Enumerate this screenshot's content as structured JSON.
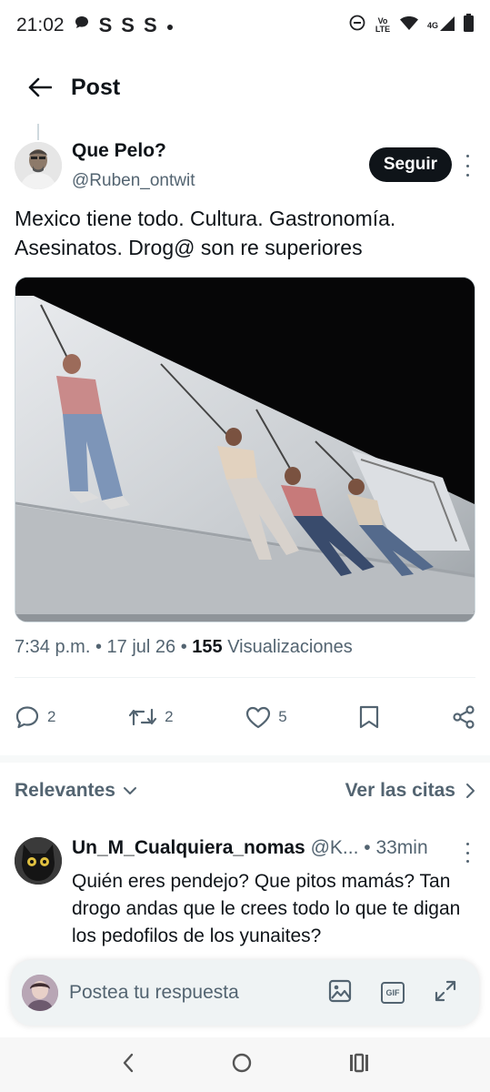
{
  "status_bar": {
    "time": "21:02",
    "app_letters": [
      "S",
      "S",
      "S"
    ],
    "volte_label": "Vo LTE",
    "network": "4G"
  },
  "header": {
    "title": "Post"
  },
  "post": {
    "author_name": "Que Pelo?",
    "author_handle": "@Ruben_ontwit",
    "follow_label": "Seguir",
    "text": "Mexico tiene todo. Cultura. Gastronomía. Asesinatos. Drog@ son re superiores",
    "time": "7:34 p.m.",
    "date": "17 jul 26",
    "views_count": "155",
    "views_label": "Visualizaciones",
    "reply_count": "2",
    "repost_count": "2",
    "like_count": "5"
  },
  "replies_section": {
    "sort_label": "Relevantes",
    "quotes_label": "Ver las citas"
  },
  "reply": {
    "name": "Un_M_Cualquiera_nomas",
    "handle": "@K...",
    "time": "33min",
    "text": "Quién eres pendejo? Que pitos mamás? Tan drogo andas que le crees todo lo que te digan los pedofilos de los yunaites?"
  },
  "composer": {
    "placeholder": "Postea tu respuesta",
    "gif_label": "GIF"
  },
  "colors": {
    "text_primary": "#0f1419",
    "text_secondary": "#536471",
    "follow_bg": "#0f1419",
    "divider": "#eff3f4"
  }
}
